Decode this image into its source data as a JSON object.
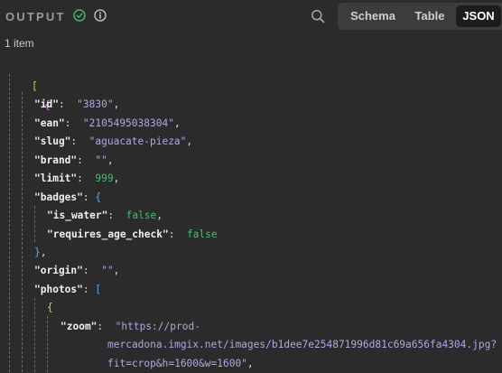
{
  "header": {
    "title": "OUTPUT",
    "tabs": [
      {
        "label": "Schema"
      },
      {
        "label": "Table"
      },
      {
        "label": "JSON"
      }
    ],
    "active_tab": "JSON",
    "status_color": "#3fbf6f"
  },
  "count_label": "1 item",
  "json_lines": {
    "open_array": "[",
    "open_obj": "{",
    "id_key": "\"id\"",
    "id_val": "\"3830\"",
    "ean_key": "\"ean\"",
    "ean_val": "\"2105495038304\"",
    "slug_key": "\"slug\"",
    "slug_val": "\"aguacate-pieza\"",
    "brand_key": "\"brand\"",
    "brand_val": "\"\"",
    "limit_key": "\"limit\"",
    "limit_val": "999",
    "badges_key": "\"badges\"",
    "open_badges": "{",
    "is_water_key": "\"is_water\"",
    "is_water_val": "false",
    "age_key": "\"requires_age_check\"",
    "age_val": "false",
    "close_badges": "}",
    "origin_key": "\"origin\"",
    "origin_val": "\"\"",
    "photos_key": "\"photos\"",
    "open_photos": "[",
    "open_photo_obj": "{",
    "zoom_key": "\"zoom\"",
    "zoom_val_1": "\"https://prod-",
    "zoom_val_2": "mercadona.imgix.net/images/b1dee7e254871996d81c69a656fa4304.jpg?",
    "zoom_val_3": "fit=crop&h=1600&w=1600\""
  }
}
